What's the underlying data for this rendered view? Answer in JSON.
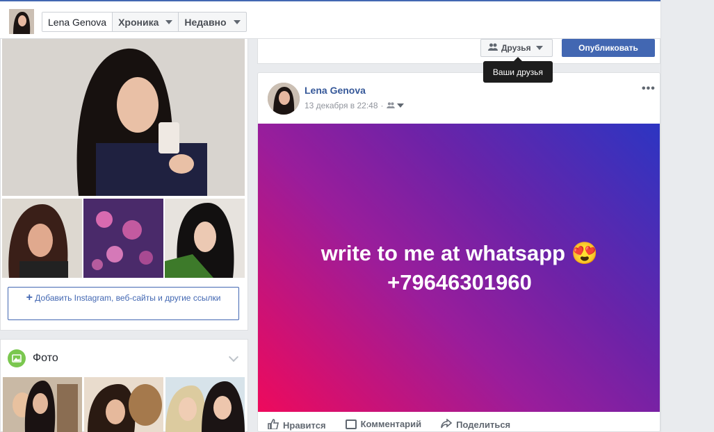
{
  "header": {
    "name": "Lena Genova",
    "timeline": "Хроника",
    "recent": "Недавно"
  },
  "intro": {
    "add_links": "Добавить Instagram, веб-сайты и другие ссылки"
  },
  "photos": {
    "title": "Фото"
  },
  "composer": {
    "audience_label": "Друзья",
    "publish_label": "Опубликовать",
    "tooltip": "Ваши друзья"
  },
  "post": {
    "author": "Lena Genova",
    "timestamp": "13 декабря в 22:48",
    "text": "write to me at whatsapp 😍 +79646301960",
    "actions": {
      "like": "Нравится",
      "comment": "Комментарий",
      "share": "Поделиться"
    }
  },
  "colors": {
    "brand": "#4267b2",
    "link": "#365899",
    "gradient_start": "#2c35c2",
    "gradient_end": "#ee0a5c"
  },
  "icons": [
    "friends-icon",
    "plus-icon",
    "photo-icon",
    "chevron-down-icon",
    "more-icon",
    "like-icon",
    "comment-icon",
    "share-icon"
  ]
}
